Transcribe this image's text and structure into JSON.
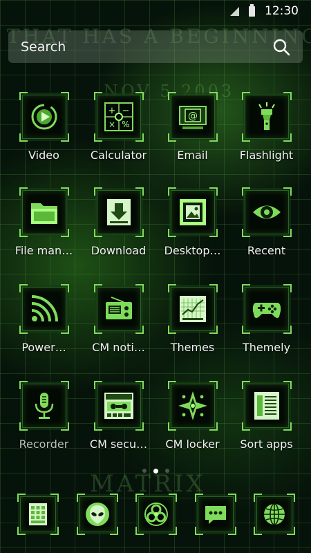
{
  "status_bar": {
    "time": "12:30"
  },
  "search": {
    "label": "Search"
  },
  "colors": {
    "accent": "#7fdc5a",
    "icon_bg": "#030a04"
  },
  "rows": [
    [
      {
        "label": "Video",
        "icon": "play-icon"
      },
      {
        "label": "Calculator",
        "icon": "calculator-icon"
      },
      {
        "label": "Email",
        "icon": "email-icon"
      },
      {
        "label": "Flashlight",
        "icon": "flashlight-icon"
      }
    ],
    [
      {
        "label": "File man…",
        "icon": "folder-icon"
      },
      {
        "label": "Download",
        "icon": "download-icon"
      },
      {
        "label": "Desktop…",
        "icon": "picture-frame-icon"
      },
      {
        "label": "Recent",
        "icon": "eye-icon"
      }
    ],
    [
      {
        "label": "Power…",
        "icon": "wifi-signal-icon"
      },
      {
        "label": "CM noti…",
        "icon": "radio-icon"
      },
      {
        "label": "Themes",
        "icon": "chart-icon"
      },
      {
        "label": "Themely",
        "icon": "gamepad-icon"
      }
    ],
    [
      {
        "label": "Recorder",
        "icon": "microphone-icon"
      },
      {
        "label": "CM secu…",
        "icon": "cassette-recorder-icon"
      },
      {
        "label": "CM locker",
        "icon": "compass-icon"
      },
      {
        "label": "Sort apps",
        "icon": "document-list-icon"
      }
    ]
  ],
  "dock": [
    {
      "icon": "app-drawer-grid-icon"
    },
    {
      "icon": "alien-icon"
    },
    {
      "icon": "biohazard-icon"
    },
    {
      "icon": "message-bubble-icon"
    },
    {
      "icon": "globe-icon"
    }
  ]
}
